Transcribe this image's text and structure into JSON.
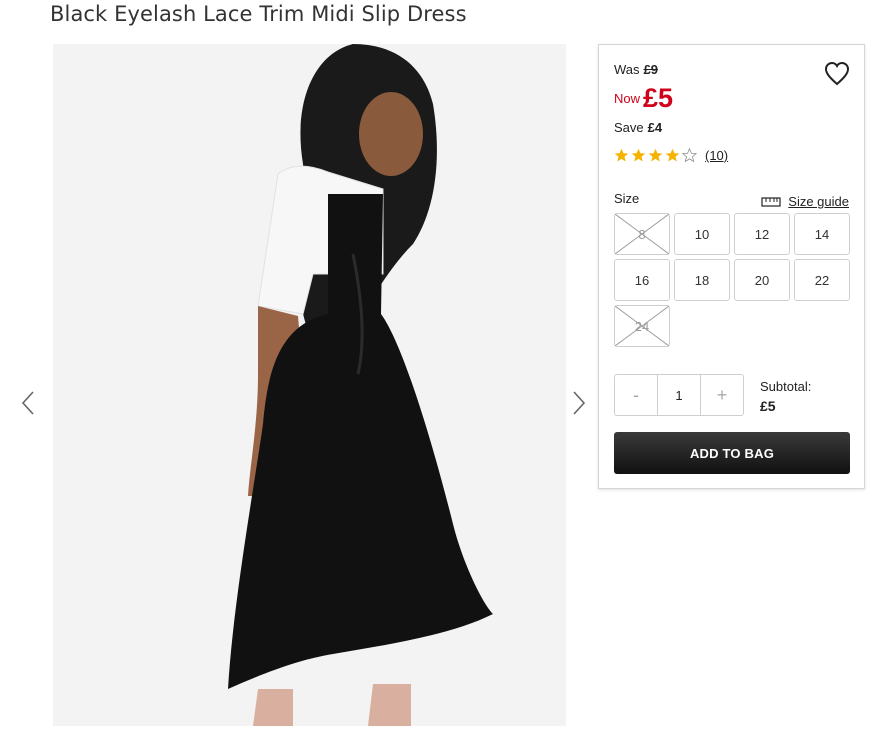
{
  "product": {
    "title": "Black Eyelash Lace Trim Midi Slip Dress"
  },
  "pricing": {
    "was_label": "Was",
    "was_price": "£9",
    "now_label": "Now",
    "now_price": "£5",
    "save_label": "Save",
    "save_amount": "£4",
    "now_color": "#d0021b"
  },
  "rating": {
    "value": 4,
    "max": 5,
    "reviews_text": "(10)",
    "star_color": "#f5b301"
  },
  "size": {
    "label": "Size",
    "guide_label": "Size guide",
    "options": [
      {
        "label": "8",
        "available": false
      },
      {
        "label": "10",
        "available": true
      },
      {
        "label": "12",
        "available": true
      },
      {
        "label": "14",
        "available": true
      },
      {
        "label": "16",
        "available": true
      },
      {
        "label": "18",
        "available": true
      },
      {
        "label": "20",
        "available": true
      },
      {
        "label": "22",
        "available": true
      },
      {
        "label": "24",
        "available": false
      }
    ]
  },
  "quantity": {
    "minus": "-",
    "value": "1",
    "plus": "+"
  },
  "subtotal": {
    "label": "Subtotal:",
    "value": "£5"
  },
  "cart": {
    "add_label": "ADD TO BAG"
  },
  "icons": {
    "heart": "heart-icon",
    "ruler": "ruler-icon",
    "prev": "chevron-left-icon",
    "next": "chevron-right-icon"
  }
}
